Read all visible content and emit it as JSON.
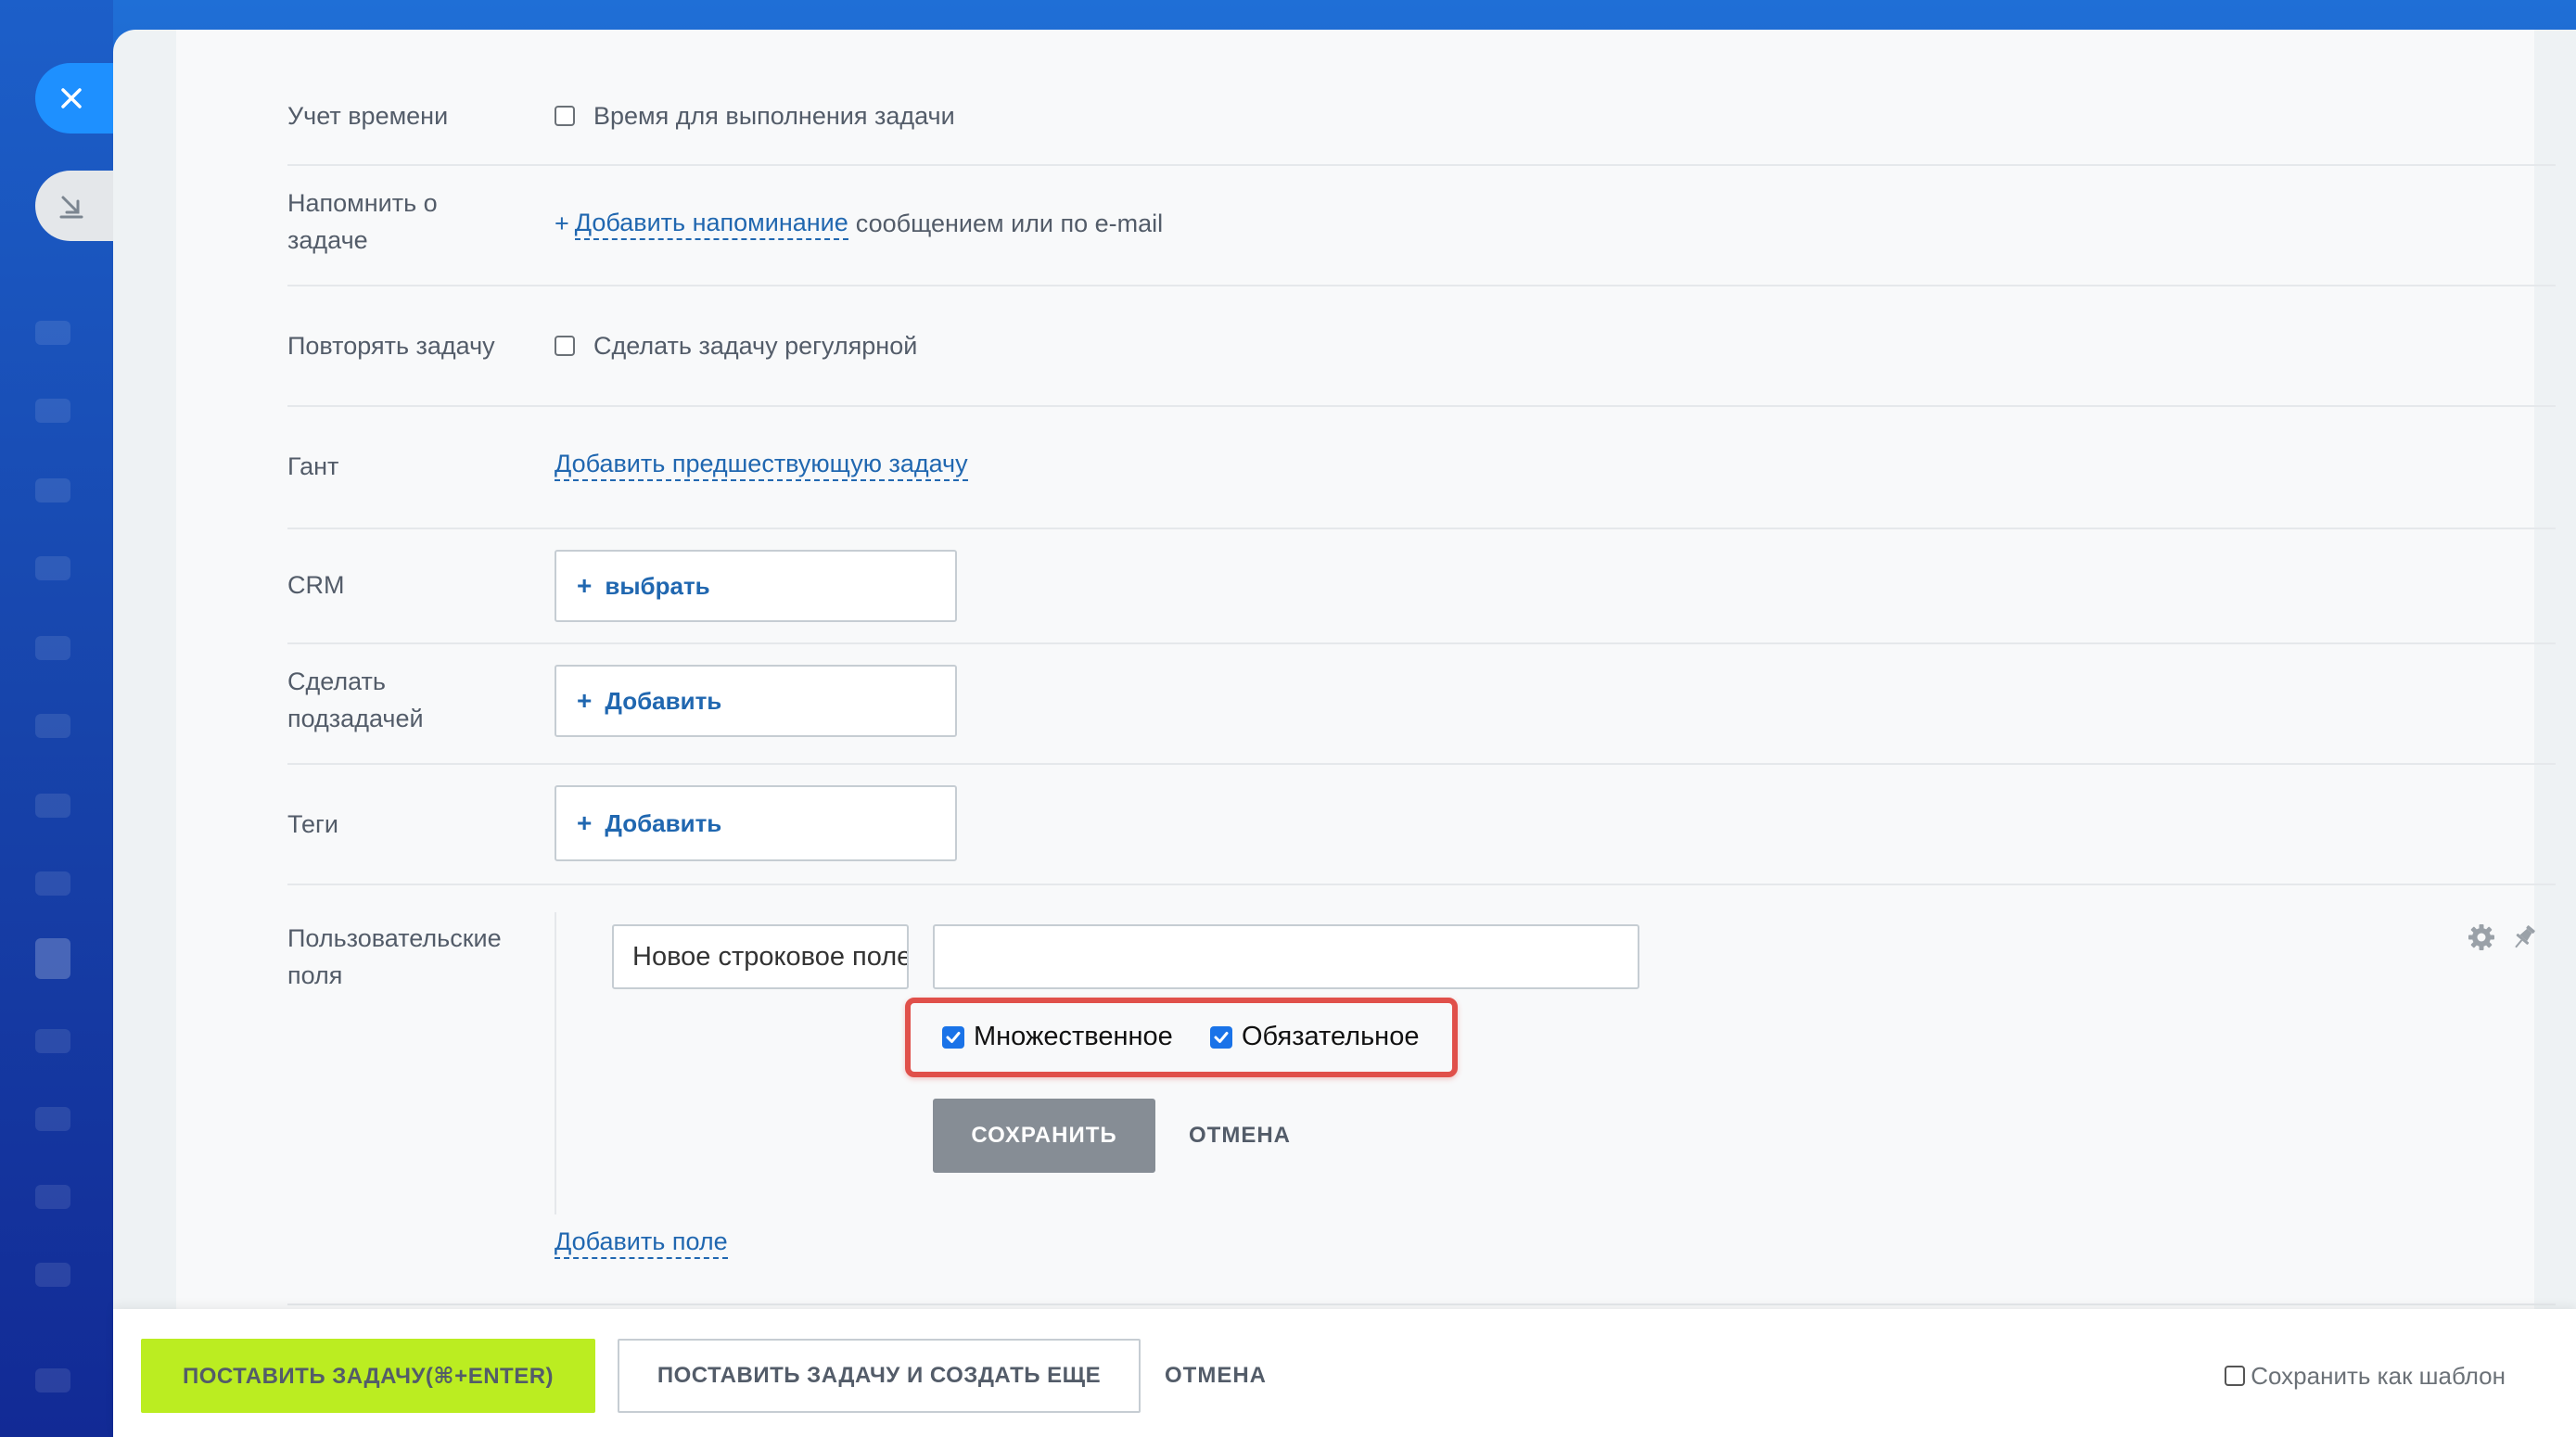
{
  "window": {
    "close_icon": "close-icon",
    "minimize_icon": "arrow-down-right-icon"
  },
  "rows": {
    "time_tracking": {
      "label": "Учет времени",
      "checkbox_label": "Время для выполнения задачи",
      "checked": false
    },
    "reminder": {
      "label_line1": "Напомнить о",
      "label_line2": "задаче",
      "plus": "+",
      "link": "Добавить напоминание",
      "suffix": "сообщением или по e-mail"
    },
    "repeat": {
      "label": "Повторять задачу",
      "checkbox_label": "Сделать задачу регулярной",
      "checked": false
    },
    "gantt": {
      "label": "Гант",
      "link": "Добавить предшествующую задачу"
    },
    "crm": {
      "label": "CRM",
      "plus": "+",
      "button": "выбрать"
    },
    "subtask": {
      "label_line1": "Сделать",
      "label_line2": "подзадачей",
      "plus": "+",
      "button": "Добавить"
    },
    "tags": {
      "label": "Теги",
      "plus": "+",
      "button": "Добавить"
    }
  },
  "custom_fields": {
    "label_line1": "Пользовательские",
    "label_line2": "поля",
    "name_value": "Новое строковое поле",
    "value": "",
    "multiple_label": "Множественное",
    "multiple_checked": true,
    "required_label": "Обязательное",
    "required_checked": true,
    "save_label": "СОХРАНИТЬ",
    "cancel_label": "ОТМЕНА",
    "add_field_link": "Добавить поле",
    "settings_icon": "gear-icon",
    "pin_icon": "pin-icon",
    "highlight_color": "#e0504a"
  },
  "footer": {
    "primary_label": "ПОСТАВИТЬ ЗАДАЧУ(⌘+ENTER)",
    "secondary_label": "ПОСТАВИТЬ ЗАДАЧУ И СОЗДАТЬ ЕЩЕ",
    "cancel_label": "ОТМЕНА",
    "template_label": "Сохранить как шаблон",
    "template_checked": false
  },
  "colors": {
    "accent_green": "#bbed21",
    "link_blue": "#2067b0",
    "checkbox_blue": "#1a73e8"
  }
}
